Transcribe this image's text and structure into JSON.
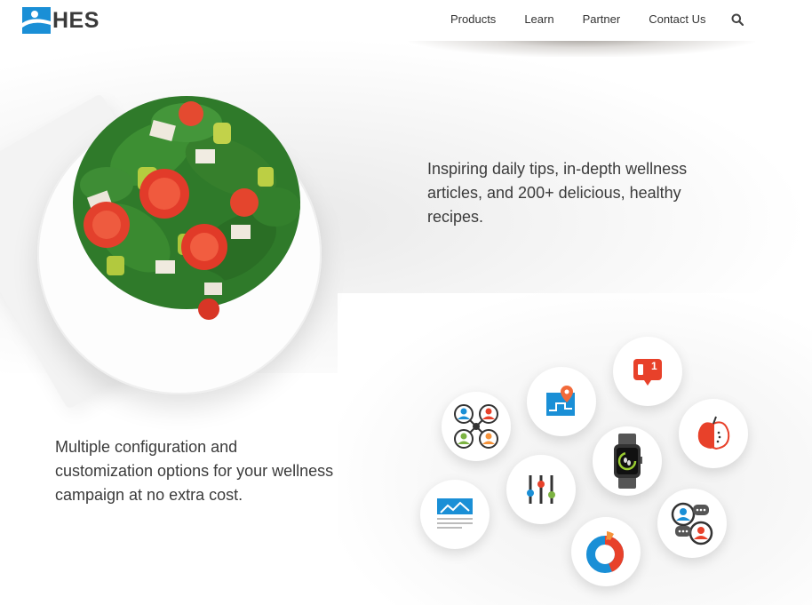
{
  "header": {
    "logo_text": "HES",
    "logo_colors": {
      "mark": "#1a8fd6",
      "text": "#3a3a3a"
    },
    "nav": [
      {
        "label": "Products"
      },
      {
        "label": "Learn"
      },
      {
        "label": "Partner"
      },
      {
        "label": "Contact Us"
      }
    ],
    "search_icon": "search-icon"
  },
  "sections": {
    "tips": {
      "text": "Inspiring daily tips, in-depth wellness articles, and 200+ delicious, healthy recipes.",
      "image": "salad-bowl"
    },
    "customization": {
      "text": "Multiple configuration and customization options for your wellness campaign at no extra cost.",
      "icons": [
        "team-network-icon",
        "map-pin-icon",
        "notification-icon",
        "apple-icon",
        "smartwatch-icon",
        "sliders-icon",
        "chat-users-icon",
        "article-icon",
        "donut-chart-icon"
      ],
      "notification_count": "1"
    }
  },
  "colors": {
    "blue": "#1a8fd6",
    "red": "#e8412a",
    "orange": "#f5933b",
    "green": "#7cb342",
    "dark": "#333333"
  }
}
